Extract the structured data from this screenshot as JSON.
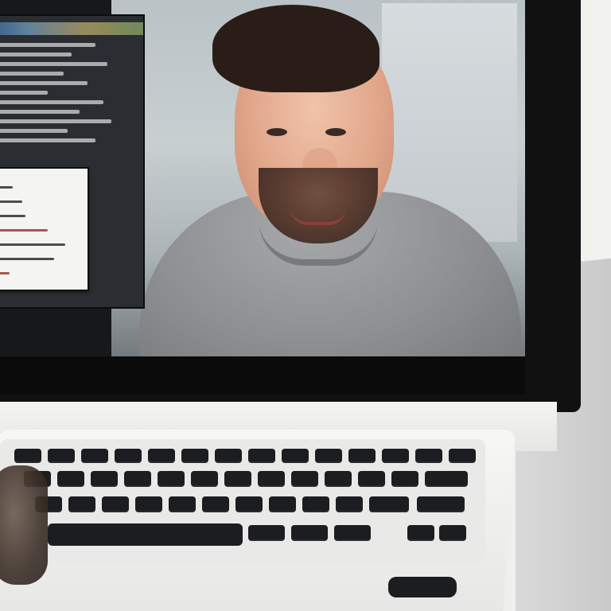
{
  "scene": {
    "type": "photo",
    "subject": "",
    "colors": {
      "monitor": "#111111",
      "wall": "#e9e9e7",
      "shirt": "#8d8f92",
      "skin": "#e2a88c",
      "hair": "#2a1d17",
      "keyboard_keys": "#1b1d20",
      "keyboard_body": "#f2f2f0",
      "accent_teal": "#2aa7b7"
    }
  }
}
